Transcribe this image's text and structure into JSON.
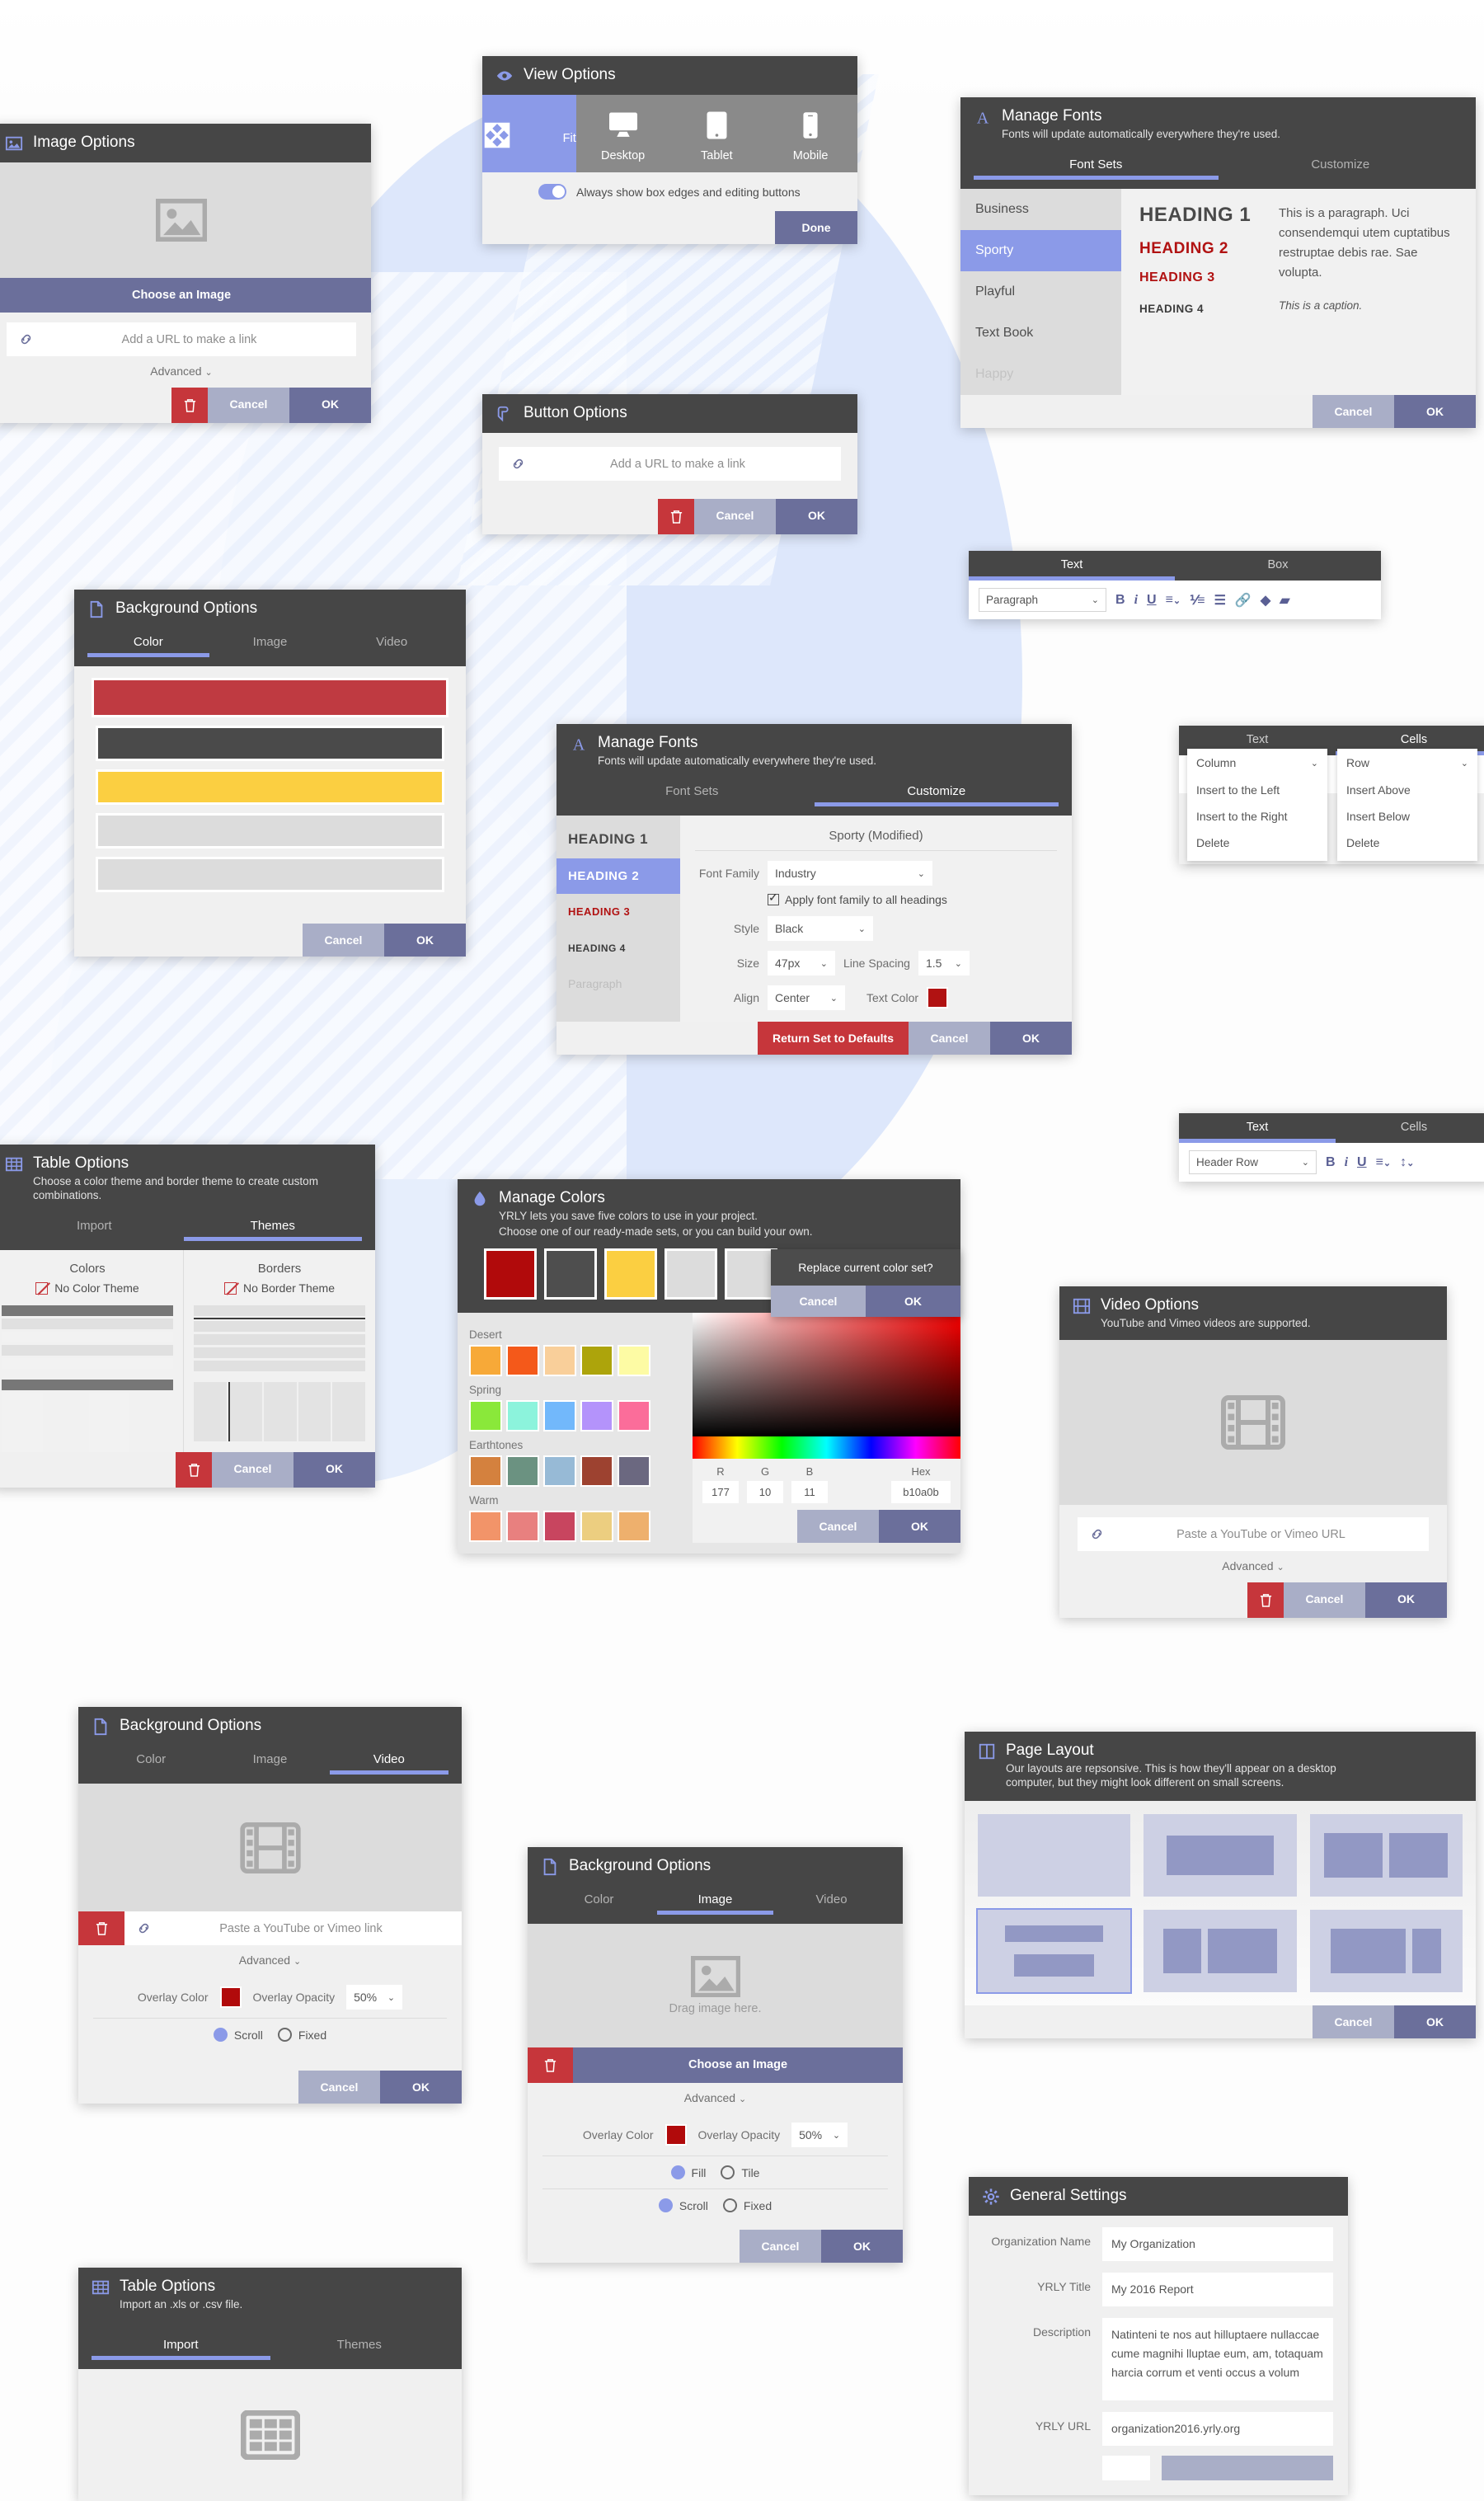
{
  "colors": {
    "header_dark": "#464646",
    "accent_periwinkle": "#8b9ae8",
    "ok_button": "#6b6f9b",
    "cancel_button": "#a9aec7",
    "danger_red": "#c6363b",
    "brand_red": "#b11212",
    "brand_yellow": "#fbcf41"
  },
  "image_options": {
    "title": "Image Options",
    "icon": "image-icon",
    "choose_label": "Choose an Image",
    "url_placeholder": "Add a URL to make a link",
    "advanced_label": "Advanced",
    "cancel_label": "Cancel",
    "ok_label": "OK"
  },
  "view_options": {
    "title": "View Options",
    "icon": "eye-icon",
    "modes": [
      {
        "label": "Fit",
        "icon": "expand-arrows-icon",
        "selected": true
      },
      {
        "label": "Desktop",
        "icon": "desktop-icon",
        "selected": false
      },
      {
        "label": "Tablet",
        "icon": "tablet-icon",
        "selected": false
      },
      {
        "label": "Mobile",
        "icon": "mobile-icon",
        "selected": false
      }
    ],
    "toggle_label": "Always show box edges and editing buttons",
    "toggle_on": true,
    "done_label": "Done"
  },
  "manage_fonts": {
    "title": "Manage Fonts",
    "icon": "font-a-icon",
    "subtitle": "Fonts will update automatically everywhere they're used.",
    "tabs": [
      {
        "label": "Font Sets",
        "active": true
      },
      {
        "label": "Customize",
        "active": false
      }
    ],
    "sets": [
      "Business",
      "Sporty",
      "Playful",
      "Text Book",
      "Happy"
    ],
    "selected_set": "Sporty",
    "preview": {
      "h1": "HEADING 1",
      "h2": "HEADING 2",
      "h3": "HEADING 3",
      "h4": "HEADING 4",
      "paragraph": "This is a paragraph. Uci consendemqui utem cuptatibus restruptae debis rae. Sae volupta.",
      "caption": "This is a caption."
    },
    "cancel_label": "Cancel",
    "ok_label": "OK"
  },
  "button_options": {
    "title": "Button Options",
    "icon": "cursor-click-icon",
    "url_placeholder": "Add a URL to make a link",
    "cancel_label": "Cancel",
    "ok_label": "OK"
  },
  "text_toolbar": {
    "tabs": [
      {
        "label": "Text",
        "active": true
      },
      {
        "label": "Box",
        "active": false
      }
    ],
    "style_value": "Paragraph",
    "tools": [
      "bold-icon",
      "italic-icon",
      "underline-icon",
      "align-icon",
      "ordered-list-icon",
      "bullet-list-icon",
      "link-icon",
      "color-drop-icon",
      "eraser-icon"
    ]
  },
  "bg_color": {
    "title": "Background Options",
    "icon": "page-icon",
    "tabs": [
      {
        "label": "Color",
        "active": true
      },
      {
        "label": "Image",
        "active": false
      },
      {
        "label": "Video",
        "active": false
      }
    ],
    "swatches": [
      "#bf3a41",
      "#4a4a4a",
      "#fbcf41",
      "#dcdcdc",
      "#dcdcdc"
    ],
    "cancel_label": "Cancel",
    "ok_label": "OK"
  },
  "mf_customize": {
    "title": "Manage Fonts",
    "icon": "font-a-icon",
    "subtitle": "Fonts will update automatically everywhere they're used.",
    "tabs": [
      {
        "label": "Font Sets",
        "active": false
      },
      {
        "label": "Customize",
        "active": true
      }
    ],
    "levels": [
      "HEADING 1",
      "HEADING 2",
      "HEADING 3",
      "HEADING 4",
      "Paragraph"
    ],
    "selected_level": "HEADING 2",
    "set_name": "Sporty (Modified)",
    "font_family_label": "Font Family",
    "font_family_value": "Industry",
    "apply_all_label": "Apply font family to all headings",
    "apply_all_checked": true,
    "style_label": "Style",
    "style_value": "Black",
    "size_label": "Size",
    "size_value": "47px",
    "line_spacing_label": "Line Spacing",
    "line_spacing_value": "1.5",
    "align_label": "Align",
    "align_value": "Center",
    "text_color_label": "Text Color",
    "text_color_value": "#b11212",
    "reset_label": "Return Set to Defaults",
    "cancel_label": "Cancel",
    "ok_label": "OK"
  },
  "swatch_popup": {
    "row1": [
      "#000000",
      "#3f3f3f",
      "#858585",
      "#bcbcbc",
      "#ffffff"
    ],
    "row2": [
      "#b10a0b",
      "#4e4e4e",
      "#fbcf41",
      "#dcdcdc",
      "#dcdcdc"
    ]
  },
  "cells_toolbar": {
    "tabs": [
      {
        "label": "Text",
        "active": false
      },
      {
        "label": "Cells",
        "active": true
      }
    ],
    "column_menu": {
      "title": "Column",
      "items": [
        "Insert to the Left",
        "Insert to the Right",
        "Delete"
      ]
    },
    "row_menu": {
      "title": "Row",
      "items": [
        "Insert Above",
        "Insert Below",
        "Delete"
      ]
    }
  },
  "cells_toolbar_text": {
    "tabs": [
      {
        "label": "Text",
        "active": true
      },
      {
        "label": "Cells",
        "active": false
      }
    ],
    "style_value": "Header Row",
    "tools": [
      "bold-icon",
      "italic-icon",
      "underline-icon",
      "align-icon",
      "line-height-icon"
    ]
  },
  "table_themes": {
    "title": "Table Options",
    "icon": "table-icon",
    "subtitle": "Choose a color theme and border theme to create custom combinations.",
    "tabs": [
      {
        "label": "Import",
        "active": false
      },
      {
        "label": "Themes",
        "active": true
      }
    ],
    "colors_title": "Colors",
    "no_color_label": "No Color Theme",
    "borders_title": "Borders",
    "no_border_label": "No Border Theme",
    "cancel_label": "Cancel",
    "ok_label": "OK"
  },
  "manage_colors": {
    "title": "Manage Colors",
    "icon": "water-drop-icon",
    "subtitle_line1": "YRLY lets you save five colors to use in your project.",
    "subtitle_line2": "Choose one of our ready-made sets, or you can build your own.",
    "current_set": [
      "#b10a0b",
      "#4e4e4e",
      "#fbcf41",
      "#dcdcdc",
      "#dcdcdc"
    ],
    "eyedropper_icon": "eyedropper-icon",
    "palettes": [
      {
        "name": "Desert",
        "colors": [
          "#f7a938",
          "#f4591a",
          "#f9cf9a",
          "#ada40b",
          "#fdfba4"
        ]
      },
      {
        "name": "Spring",
        "colors": [
          "#8ae83a",
          "#8cf3dc",
          "#72b8fb",
          "#b493fb",
          "#fb6d9a"
        ]
      },
      {
        "name": "Earthtones",
        "colors": [
          "#d4813e",
          "#6b9281",
          "#97bad6",
          "#9d4230",
          "#6b6880"
        ]
      },
      {
        "name": "Warm",
        "colors": [
          "#f29469",
          "#e8807f",
          "#c8455f",
          "#ecce80",
          "#eeb06d"
        ]
      }
    ],
    "confirm": {
      "message": "Replace current color set?",
      "cancel_label": "Cancel",
      "ok_label": "OK"
    },
    "rgb": {
      "r_label": "R",
      "r_value": "177",
      "g_label": "G",
      "g_value": "10",
      "b_label": "B",
      "b_value": "11",
      "hex_label": "Hex",
      "hex_value": "b10a0b"
    },
    "cancel_label": "Cancel",
    "ok_label": "OK"
  },
  "video_options": {
    "title": "Video Options",
    "icon": "film-icon",
    "subtitle": "YouTube and Vimeo videos are supported.",
    "url_placeholder": "Paste a YouTube or Vimeo URL",
    "advanced_label": "Advanced",
    "cancel_label": "Cancel",
    "ok_label": "OK"
  },
  "bg_video": {
    "title": "Background Options",
    "icon": "page-icon",
    "tabs": [
      {
        "label": "Color",
        "active": false
      },
      {
        "label": "Image",
        "active": false
      },
      {
        "label": "Video",
        "active": true
      }
    ],
    "url_placeholder": "Paste a YouTube or Vimeo link",
    "advanced_label": "Advanced",
    "overlay_color_label": "Overlay Color",
    "overlay_color_value": "#b10a0b",
    "overlay_opacity_label": "Overlay Opacity",
    "overlay_opacity_value": "50%",
    "scroll_label": "Scroll",
    "fixed_label": "Fixed",
    "position_selected": "Scroll",
    "cancel_label": "Cancel",
    "ok_label": "OK"
  },
  "bg_image": {
    "title": "Background Options",
    "icon": "page-icon",
    "tabs": [
      {
        "label": "Color",
        "active": false
      },
      {
        "label": "Image",
        "active": true
      },
      {
        "label": "Video",
        "active": false
      }
    ],
    "drop_label": "Drag image here.",
    "choose_label": "Choose an Image",
    "advanced_label": "Advanced",
    "overlay_color_label": "Overlay Color",
    "overlay_color_value": "#b10a0b",
    "overlay_opacity_label": "Overlay Opacity",
    "overlay_opacity_value": "50%",
    "fill_label": "Fill",
    "tile_label": "Tile",
    "scroll_label": "Scroll",
    "fixed_label": "Fixed",
    "size_selected": "Fill",
    "position_selected": "Scroll",
    "cancel_label": "Cancel",
    "ok_label": "OK"
  },
  "page_layout": {
    "title": "Page Layout",
    "icon": "columns-icon",
    "subtitle": "Our layouts are repsonsive. This is how they'll appear on a desktop computer, but they might look different on small screens.",
    "selected_index": 3,
    "cancel_label": "Cancel",
    "ok_label": "OK"
  },
  "general_settings": {
    "title": "General Settings",
    "icon": "gear-icon",
    "fields": [
      {
        "label": "Organization Name",
        "value": "My Organization"
      },
      {
        "label": "YRLY Title",
        "value": "My 2016 Report"
      },
      {
        "label": "Description",
        "value": "Natinteni te nos aut hilluptaere nullaccae cume magnihi lluptae eum, am, totaquam harcia corrum et venti occus a volum"
      },
      {
        "label": "YRLY URL",
        "value": "organization2016.yrly.org"
      }
    ]
  },
  "table_import": {
    "title": "Table Options",
    "icon": "table-icon",
    "subtitle": "Import an .xls or .csv file.",
    "tabs": [
      {
        "label": "Import",
        "active": true
      },
      {
        "label": "Themes",
        "active": false
      }
    ]
  }
}
